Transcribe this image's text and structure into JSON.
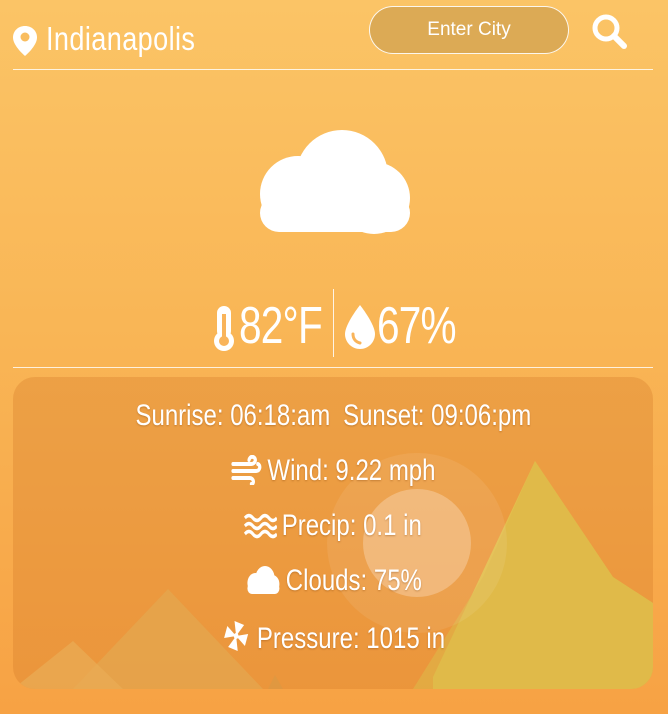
{
  "header": {
    "location": "Indianapolis",
    "search_placeholder": "Enter City"
  },
  "current": {
    "temperature": "82°F",
    "humidity": "67%",
    "condition_icon": "cloud-icon"
  },
  "details": {
    "sunrise_label": "Sunrise:",
    "sunrise_value": "06:18:am",
    "sunset_label": "Sunset:",
    "sunset_value": "09:06:pm",
    "wind_label": "Wind:",
    "wind_value": "9.22 mph",
    "precip_label": "Precip:",
    "precip_value": "0.1 in",
    "clouds_label": "Clouds:",
    "clouds_value": "75%",
    "pressure_label": "Pressure:",
    "pressure_value": "1015 in"
  },
  "colors": {
    "background_top": "#fbc466",
    "background_bottom": "#f7a244",
    "input_fill": "#dcaa55",
    "text": "#ffffff"
  }
}
